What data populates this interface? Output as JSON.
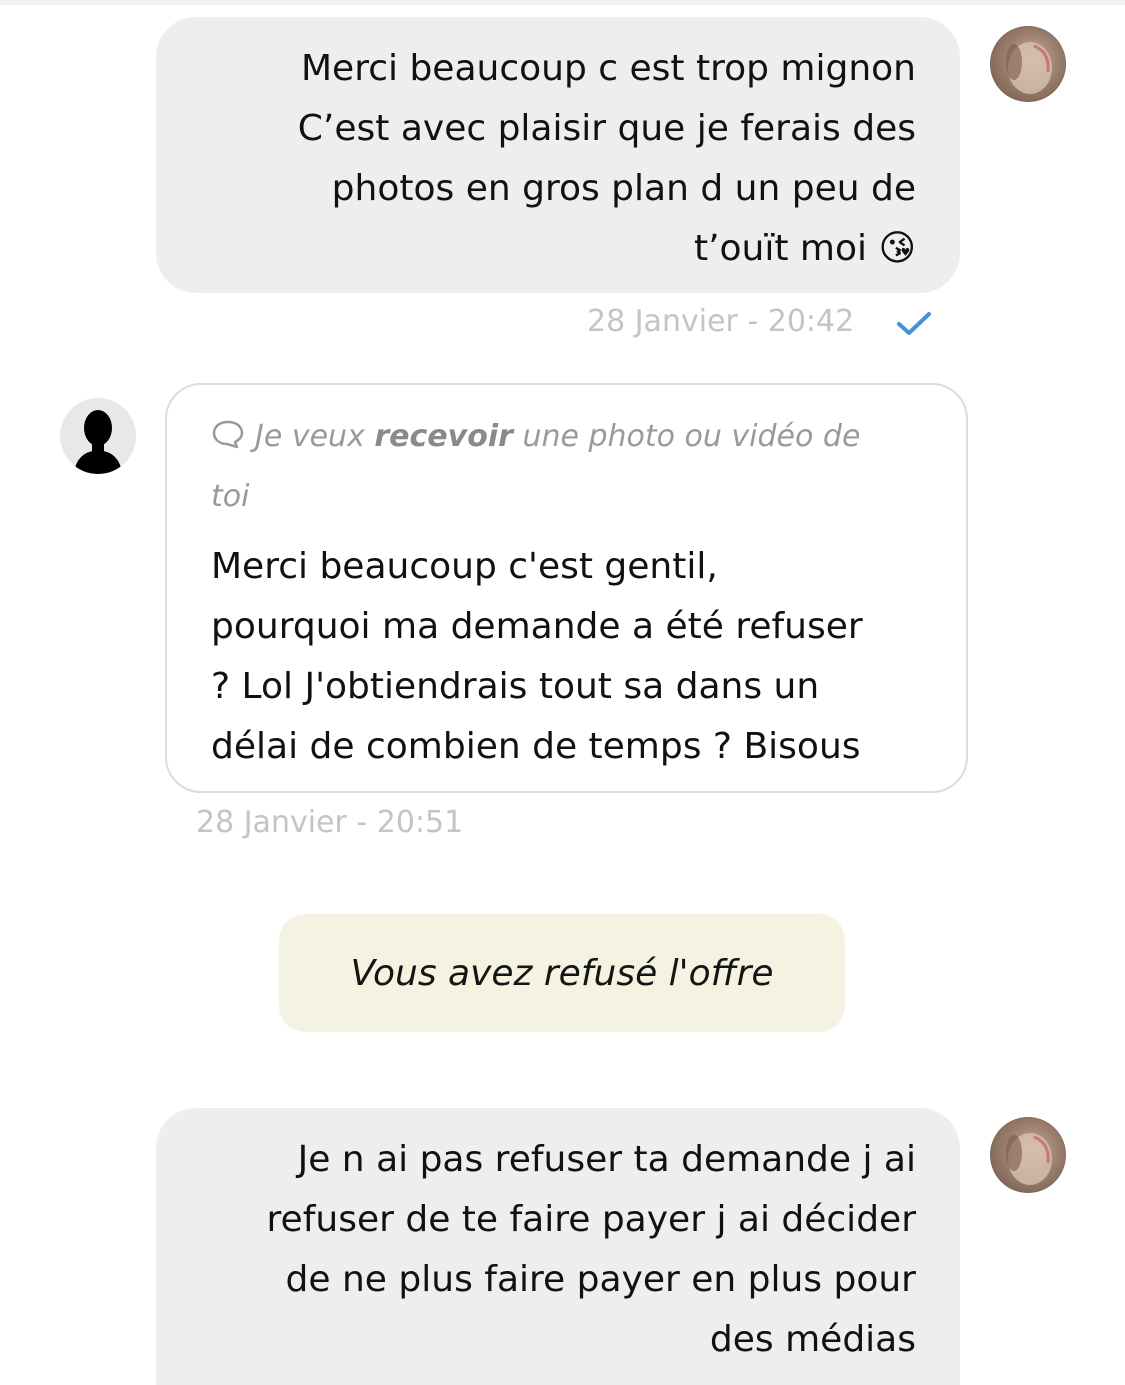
{
  "messages": [
    {
      "direction": "outgoing",
      "lines": [
        "Merci beaucoup c est trop mignon",
        "C’est avec plaisir que je ferais des",
        "photos en gros plan d un peu de",
        "t’ouït moi"
      ],
      "emoji": "😘",
      "timestamp": "28 Janvier - 20:42",
      "status_icon": "check-icon"
    },
    {
      "direction": "incoming",
      "quote": {
        "icon": "speech-bubble-icon",
        "prefix": "Je veux",
        "bold": "recevoir",
        "suffix": "une photo ou vidéo de",
        "line2": "toi"
      },
      "lines": [
        "Merci beaucoup c'est gentil,",
        "pourquoi ma demande a été refuser",
        "? Lol J'obtiendrais tout sa dans un",
        "délai de combien de temps ? Bisous"
      ],
      "timestamp": "28 Janvier - 20:51"
    },
    {
      "direction": "system",
      "text": "Vous avez refusé l'offre"
    },
    {
      "direction": "outgoing",
      "lines": [
        "Je n ai pas refuser ta demande j ai",
        "refuser de te faire payer j ai décider",
        "de ne plus faire payer en plus pour",
        "des médias"
      ]
    }
  ],
  "colors": {
    "outgoing_bubble": "#eeeeee",
    "system_bubble": "#f4f3e2",
    "timestamp": "#c4c4c4",
    "check": "#4a90d9",
    "incoming_border": "#dcdcdc"
  }
}
